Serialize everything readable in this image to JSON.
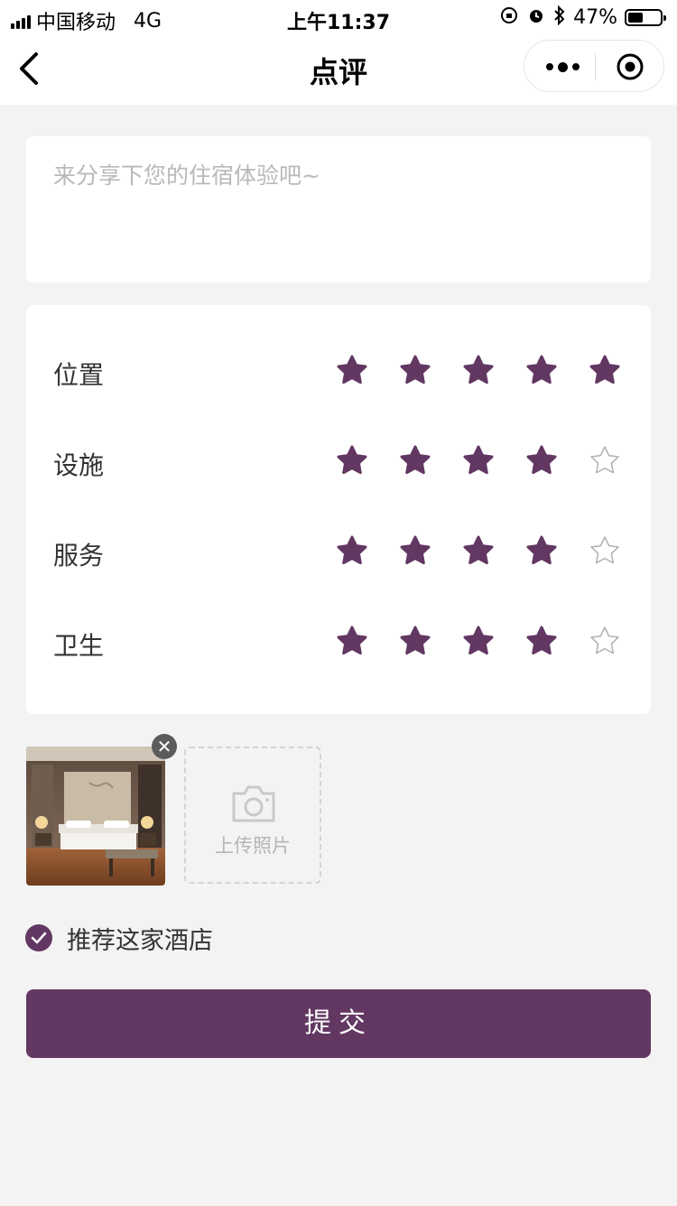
{
  "status_bar": {
    "carrier": "中国移动",
    "network": "4G",
    "time": "上午11:37",
    "battery_text": "47%",
    "battery_level": 0.47
  },
  "nav": {
    "title": "点评",
    "back_icon": "chevron-left-icon",
    "more_icon": "more-dots-icon",
    "close_icon": "target-circle-icon"
  },
  "review": {
    "placeholder": "来分享下您的住宿体验吧~",
    "value": ""
  },
  "ratings": [
    {
      "label": "位置",
      "score": 5,
      "max": 5
    },
    {
      "label": "设施",
      "score": 4,
      "max": 5
    },
    {
      "label": "服务",
      "score": 4,
      "max": 5
    },
    {
      "label": "卫生",
      "score": 4,
      "max": 5
    }
  ],
  "photos": {
    "upload_label": "上传照片",
    "upload_icon": "camera-icon",
    "remove_icon": "close-icon"
  },
  "recommend": {
    "label": "推荐这家酒店",
    "checked": true
  },
  "submit": {
    "label": "提交"
  },
  "colors": {
    "accent": "#623762",
    "star_empty_stroke": "#b0b0b0",
    "background": "#f4f3f4"
  }
}
